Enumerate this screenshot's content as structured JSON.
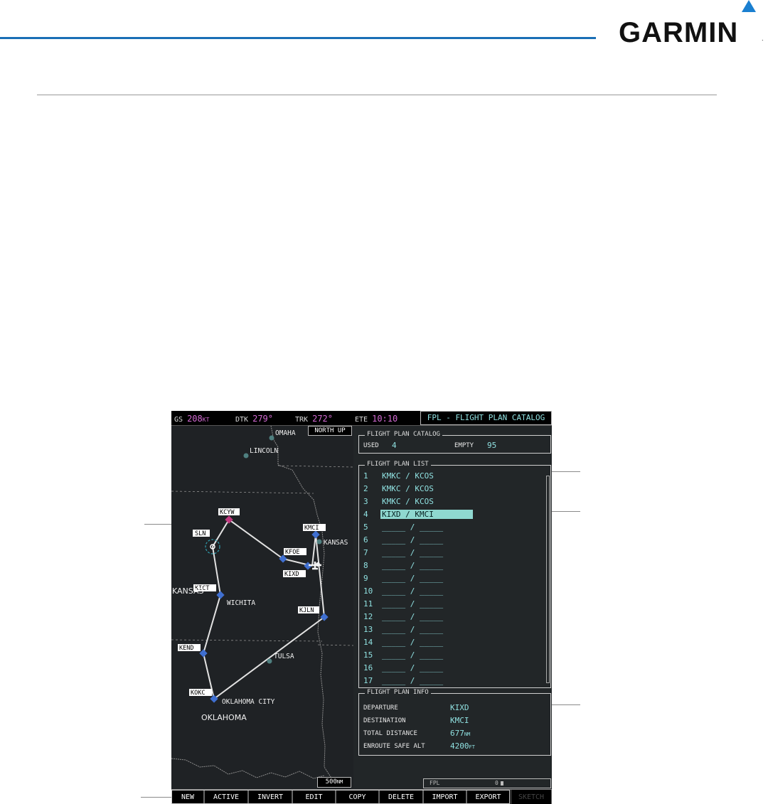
{
  "brand": {
    "name": "GARMIN",
    "reg": "."
  },
  "status": {
    "gs_label": "GS",
    "gs_value": "208",
    "gs_unit": "KT",
    "dtk_label": "DTK",
    "dtk_value": "279°",
    "trk_label": "TRK",
    "trk_value": "272°",
    "ete_label": "ETE",
    "ete_value": "10:10",
    "page_title": "FPL - FLIGHT PLAN CATALOG"
  },
  "map": {
    "orientation": "NORTH UP",
    "range": "500",
    "range_unit": "NM",
    "cities": [
      "OMAHA",
      "LINCOLN",
      "KANSAS",
      "WICHITA",
      "TULSA",
      "OKLAHOMA CITY"
    ],
    "states": [
      "KANSAS",
      "OKLAHOMA"
    ],
    "waypoints": [
      "KCYW",
      "SLN",
      "KFOE",
      "KMCI",
      "KIXD",
      "KICT",
      "KJLN",
      "KEND",
      "KOKC"
    ]
  },
  "catalog": {
    "title": "FLIGHT PLAN CATALOG",
    "used_label": "USED",
    "used_value": "4",
    "empty_label": "EMPTY",
    "empty_value": "95"
  },
  "list": {
    "title": "FLIGHT PLAN LIST",
    "selected_index": 3,
    "items": [
      {
        "num": "1",
        "name": "KMKC / KCOS"
      },
      {
        "num": "2",
        "name": "KMKC / KCOS"
      },
      {
        "num": "3",
        "name": "KMKC / KCOS"
      },
      {
        "num": "4",
        "name": "KIXD / KMCI"
      },
      {
        "num": "5",
        "name": "_____ / _____"
      },
      {
        "num": "6",
        "name": "_____ / _____"
      },
      {
        "num": "7",
        "name": "_____ / _____"
      },
      {
        "num": "8",
        "name": "_____ / _____"
      },
      {
        "num": "9",
        "name": "_____ / _____"
      },
      {
        "num": "10",
        "name": "_____ / _____"
      },
      {
        "num": "11",
        "name": "_____ / _____"
      },
      {
        "num": "12",
        "name": "_____ / _____"
      },
      {
        "num": "13",
        "name": "_____ / _____"
      },
      {
        "num": "14",
        "name": "_____ / _____"
      },
      {
        "num": "15",
        "name": "_____ / _____"
      },
      {
        "num": "16",
        "name": "_____ / _____"
      },
      {
        "num": "17",
        "name": "_____ / _____"
      }
    ]
  },
  "info": {
    "title": "FLIGHT PLAN INFO",
    "departure_label": "DEPARTURE",
    "departure_value": "KIXD",
    "destination_label": "DESTINATION",
    "destination_value": "KMCI",
    "distance_label": "TOTAL DISTANCE",
    "distance_value": "677",
    "distance_unit": "NM",
    "alt_label": "ENROUTE SAFE ALT",
    "alt_value": "4200",
    "alt_unit": "FT"
  },
  "fpl_box": {
    "label": "FPL",
    "value": "0"
  },
  "softkeys": [
    "NEW",
    "ACTIVE",
    "INVERT",
    "EDIT",
    "COPY",
    "DELETE",
    "IMPORT",
    "EXPORT",
    "SKETCH"
  ],
  "colors": {
    "accent_blue": "#1a6fb6",
    "cyan_text": "#8fe0e0",
    "magenta": "#d36ad3",
    "waypoint_blue": "#3f6fd0",
    "active_waypoint": "#c0397f"
  }
}
